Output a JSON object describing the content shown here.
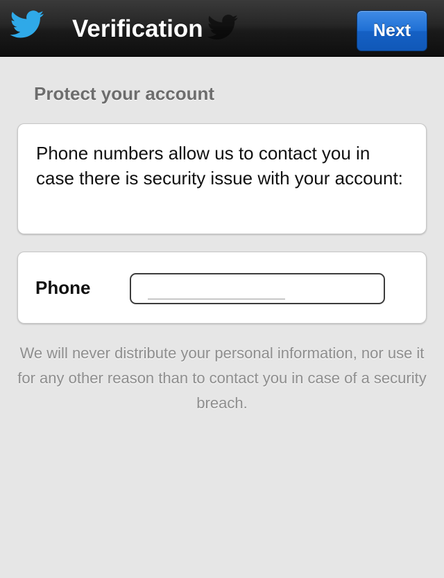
{
  "navbar": {
    "title": "Verification",
    "next_label": "Next",
    "logo_icon": "twitter-bird-icon"
  },
  "main": {
    "heading": "Protect your account",
    "info_text": "Phone numbers allow us to contact you in case there is security issue with your account:",
    "phone": {
      "label": "Phone",
      "value": "",
      "placeholder": ""
    },
    "privacy_note": "We will never distribute your personal information, nor use it for any other reason than to contact you in case of a security breach."
  },
  "colors": {
    "navbar_bg": "#1a1a1a",
    "accent_blue": "#1f6fd4",
    "logo_blue": "#2fa9e8",
    "page_bg": "#e6e6e6",
    "heading_text": "#6d6d6d",
    "muted_text": "#8e8e8e"
  }
}
